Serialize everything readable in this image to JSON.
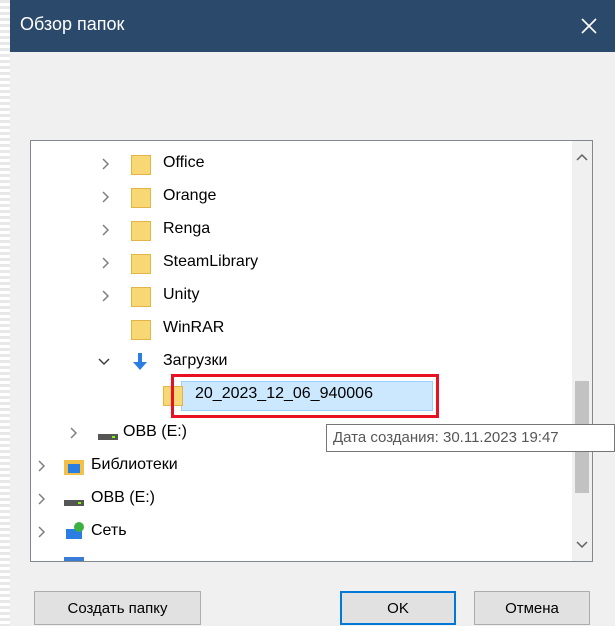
{
  "window": {
    "title": "Обзор папок",
    "close_glyph": "✕"
  },
  "tree": {
    "items": [
      {
        "label": "Office",
        "icon": "folder-icon",
        "expander": "collapsed"
      },
      {
        "label": "Orange",
        "icon": "folder-icon",
        "expander": "collapsed"
      },
      {
        "label": "Renga",
        "icon": "folder-icon",
        "expander": "collapsed"
      },
      {
        "label": "SteamLibrary",
        "icon": "folder-icon",
        "expander": "collapsed"
      },
      {
        "label": "Unity",
        "icon": "folder-icon",
        "expander": "collapsed"
      },
      {
        "label": "WinRAR",
        "icon": "folder-icon",
        "expander": "none"
      },
      {
        "label": "Загрузки",
        "icon": "download-icon",
        "expander": "expanded"
      },
      {
        "label": "20_2023_12_06_940006",
        "icon": "folder-icon",
        "expander": "none",
        "selected": true
      },
      {
        "label": "OBB (E:)",
        "icon": "drive-icon",
        "expander": "collapsed"
      },
      {
        "label": "Библиотеки",
        "icon": "libraries-icon",
        "expander": "collapsed"
      },
      {
        "label": "OBB (E:)",
        "icon": "drive-icon",
        "expander": "collapsed"
      },
      {
        "label": "Сеть",
        "icon": "network-icon",
        "expander": "collapsed"
      }
    ]
  },
  "tooltip": {
    "text": "Дата создания: 30.11.2023 19:47"
  },
  "buttons": {
    "new_folder": "Создать папку",
    "ok": "OK",
    "cancel": "Отмена"
  },
  "colors": {
    "titlebar": "#2b4a6b",
    "highlight_border": "#e81123",
    "selection": "#cce8ff",
    "folder": "#f8d775"
  }
}
